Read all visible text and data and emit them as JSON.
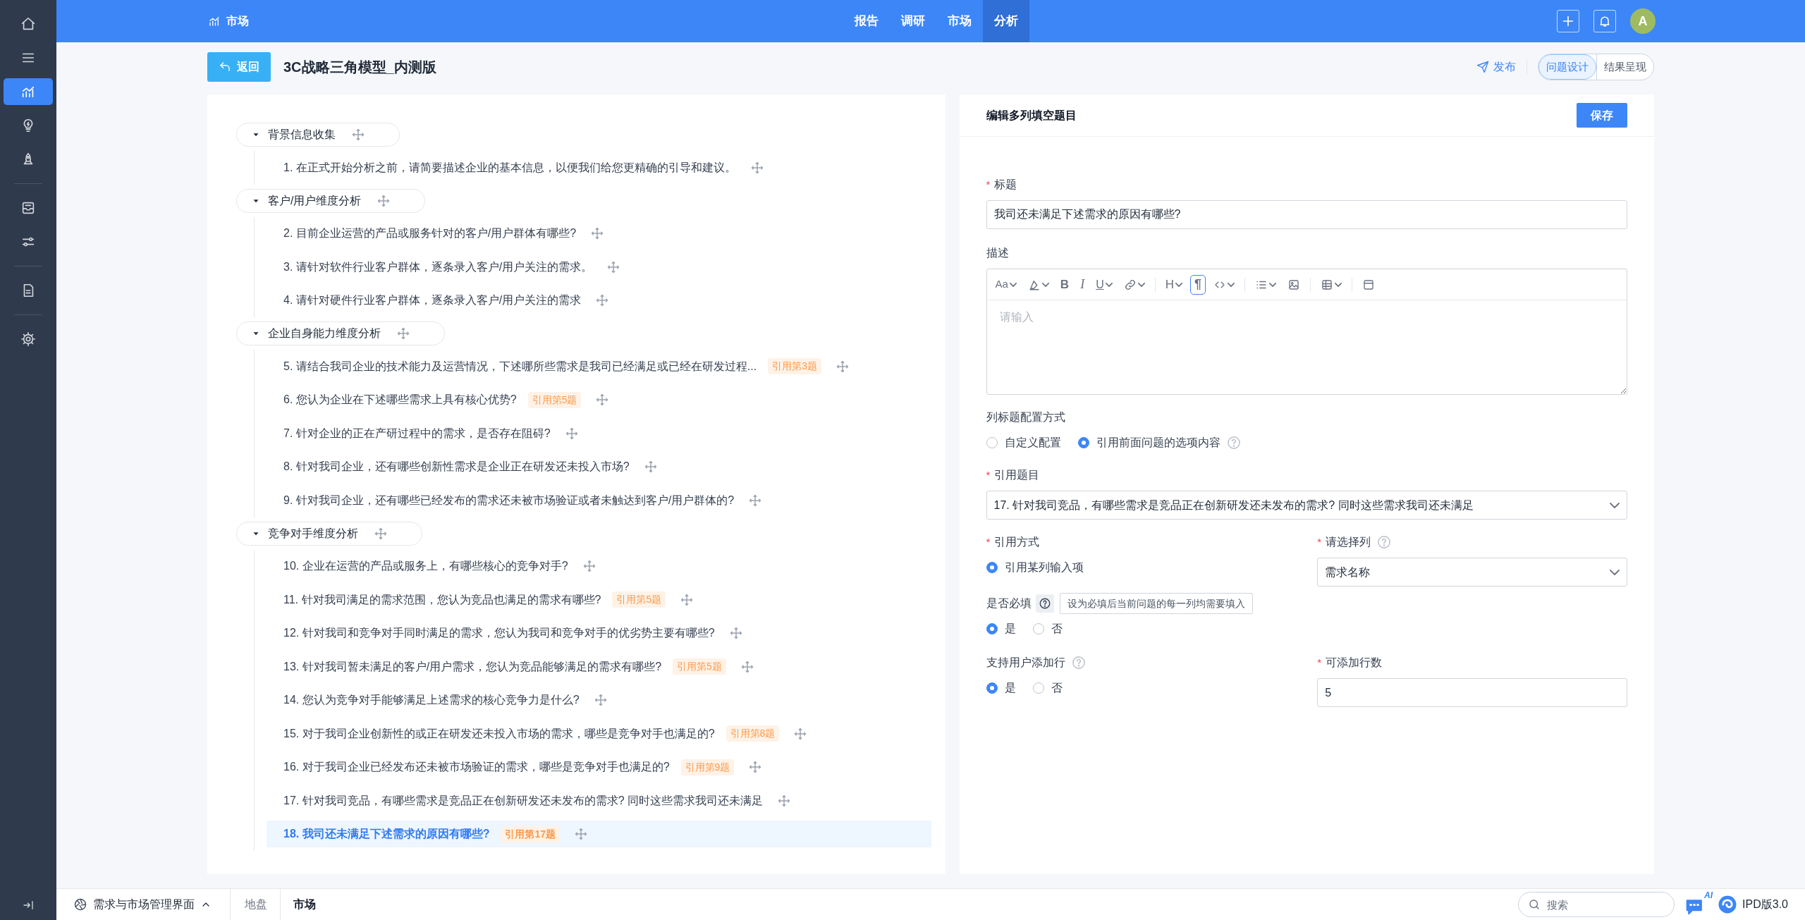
{
  "sidebar": {
    "groups": [
      {
        "items": [
          {
            "kind": "home",
            "selected": false
          },
          {
            "kind": "menu",
            "selected": false
          },
          {
            "kind": "chart",
            "selected": true
          },
          {
            "kind": "bulb",
            "selected": false
          },
          {
            "kind": "rocket",
            "selected": false
          }
        ]
      },
      {
        "items": [
          {
            "kind": "inbox",
            "selected": false
          },
          {
            "kind": "sliders",
            "selected": false
          }
        ]
      },
      {
        "items": [
          {
            "kind": "document",
            "selected": false
          }
        ]
      },
      {
        "items": [
          {
            "kind": "settings",
            "selected": false
          }
        ]
      }
    ]
  },
  "header": {
    "section": "市场",
    "nav": [
      {
        "label": "报告",
        "selected": false
      },
      {
        "label": "调研",
        "selected": false
      },
      {
        "label": "市场",
        "selected": false
      },
      {
        "label": "分析",
        "selected": true
      }
    ],
    "avatar": "A"
  },
  "toolbar": {
    "back": "返回",
    "title": "3C战略三角模型_内测版",
    "publish": "发布",
    "views": [
      {
        "label": "问题设计",
        "selected": true
      },
      {
        "label": "结果呈现",
        "selected": false
      }
    ]
  },
  "outline": {
    "groups": [
      {
        "title": "背景信息收集",
        "expanded": true,
        "children": [
          {
            "label": "1. 在正式开始分析之前，请简要描述企业的基本信息，以便我们给您更精确的引导和建议。",
            "selected": false
          }
        ]
      },
      {
        "title": "客户/用户维度分析",
        "expanded": true,
        "children": [
          {
            "label": "2. 目前企业运营的产品或服务针对的客户/用户群体有哪些?",
            "selected": false
          },
          {
            "label": "3. 请针对软件行业客户群体，逐条录入客户/用户关注的需求。",
            "selected": false
          },
          {
            "label": "4. 请针对硬件行业客户群体，逐条录入客户/用户关注的需求",
            "selected": false
          }
        ]
      },
      {
        "title": "企业自身能力维度分析",
        "expanded": true,
        "children": [
          {
            "label": "5. 请结合我司企业的技术能力及运营情况，下述哪所些需求是我司已经满足或已经在研发过程...",
            "reference": "引用第3题",
            "selected": false
          },
          {
            "label": "6. 您认为企业在下述哪些需求上具有核心优势?",
            "reference": "引用第5题",
            "selected": false
          },
          {
            "label": "7. 针对企业的正在产研过程中的需求，是否存在阻碍?",
            "selected": false
          },
          {
            "label": "8. 针对我司企业，还有哪些创新性需求是企业正在研发还未投入市场?",
            "selected": false
          },
          {
            "label": "9. 针对我司企业，还有哪些已经发布的需求还未被市场验证或者未触达到客户/用户群体的?",
            "selected": false
          }
        ]
      },
      {
        "title": "竞争对手维度分析",
        "expanded": true,
        "children": [
          {
            "label": "10. 企业在运营的产品或服务上，有哪些核心的竞争对手?",
            "selected": false
          },
          {
            "label": "11. 针对我司满足的需求范围，您认为竞品也满足的需求有哪些?",
            "reference": "引用第5题",
            "selected": false
          },
          {
            "label": "12. 针对我司和竞争对手同时满足的需求，您认为我司和竞争对手的优劣势主要有哪些?",
            "selected": false
          },
          {
            "label": "13. 针对我司暂未满足的客户/用户需求，您认为竞品能够满足的需求有哪些?",
            "reference": "引用第5题",
            "selected": false
          },
          {
            "label": "14. 您认为竞争对手能够满足上述需求的核心竞争力是什么?",
            "selected": false
          },
          {
            "label": "15. 对于我司企业创新性的或正在研发还未投入市场的需求，哪些是竞争对手也满足的?",
            "reference": "引用第8题",
            "selected": false
          },
          {
            "label": "16. 对于我司企业已经发布还未被市场验证的需求，哪些是竞争对手也满足的?",
            "reference": "引用第9题",
            "selected": false
          },
          {
            "label": "17. 针对我司竞品，有哪些需求是竞品正在创新研发还未发布的需求? 同时这些需求我司还未满足",
            "selected": false
          },
          {
            "label": "18. 我司还未满足下述需求的原因有哪些?",
            "reference": "引用第17题",
            "selected": true
          }
        ]
      }
    ]
  },
  "editor": {
    "title": "编辑多列填空题目",
    "save": "保存",
    "title_field": {
      "mark": "*",
      "label": "标题",
      "value": "我司还未满足下述需求的原因有哪些?"
    },
    "description": {
      "label": "描述",
      "placeholder": "请输入",
      "toolbar": [
        {
          "items": [
            {
              "kind": "font",
              "glyph": "Aa",
              "dropdown": true,
              "selected": false
            },
            {
              "kind": "highlight",
              "dropdown": true,
              "selected": false
            },
            {
              "kind": "bold",
              "glyph": "B",
              "selected": false
            },
            {
              "kind": "italic",
              "glyph": "I",
              "selected": false
            },
            {
              "kind": "underline",
              "glyph": "U",
              "dropdown": true,
              "selected": false
            },
            {
              "kind": "link",
              "dropdown": true,
              "selected": false
            }
          ]
        },
        {
          "items": [
            {
              "kind": "heading",
              "glyph": "H",
              "dropdown": true,
              "selected": false
            },
            {
              "kind": "paragraph",
              "glyph": "¶",
              "selected": true
            },
            {
              "kind": "code",
              "dropdown": true,
              "selected": false
            }
          ]
        },
        {
          "items": [
            {
              "kind": "list",
              "dropdown": true,
              "selected": false
            },
            {
              "kind": "image",
              "selected": false
            }
          ]
        },
        {
          "items": [
            {
              "kind": "table",
              "dropdown": true,
              "selected": false
            }
          ]
        },
        {
          "items": [
            {
              "kind": "block",
              "selected": false
            }
          ]
        }
      ]
    },
    "column_title_mode": {
      "label": "列标题配置方式",
      "options": [
        {
          "label": "自定义配置",
          "selected": false
        },
        {
          "label": "引用前面问题的选项内容",
          "selected": true,
          "help": true
        }
      ]
    },
    "reference_question": {
      "mark": "*",
      "label": "引用题目",
      "value": "17. 针对我司竞品，有哪些需求是竞品正在创新研发还未发布的需求? 同时这些需求我司还未满足"
    },
    "reference_method": {
      "mark": "*",
      "label": "引用方式",
      "options": [
        {
          "label": "引用某列输入项",
          "selected": true
        }
      ]
    },
    "column": {
      "mark": "*",
      "label": "请选择列",
      "help": true,
      "value": "需求名称"
    },
    "mandatory": {
      "label": "是否必填",
      "tooltip": "设为必填后当前问题的每一列均需要填入",
      "options": [
        {
          "label": "是",
          "selected": true
        },
        {
          "label": "否",
          "selected": false
        }
      ]
    },
    "allow_add_rows": {
      "label": "支持用户添加行",
      "help": true,
      "options": [
        {
          "label": "是",
          "selected": true
        },
        {
          "label": "否",
          "selected": false
        }
      ]
    },
    "row_count": {
      "mark": "*",
      "label": "可添加行数",
      "value": "5"
    }
  },
  "footer": {
    "app": "需求与市场管理界面",
    "crumbs": [
      {
        "label": "地盘",
        "selected": false
      },
      {
        "label": "市场",
        "selected": true
      }
    ],
    "search": {
      "placeholder": "搜索"
    },
    "ai_badge": "AI",
    "version": "IPD版3.0"
  }
}
